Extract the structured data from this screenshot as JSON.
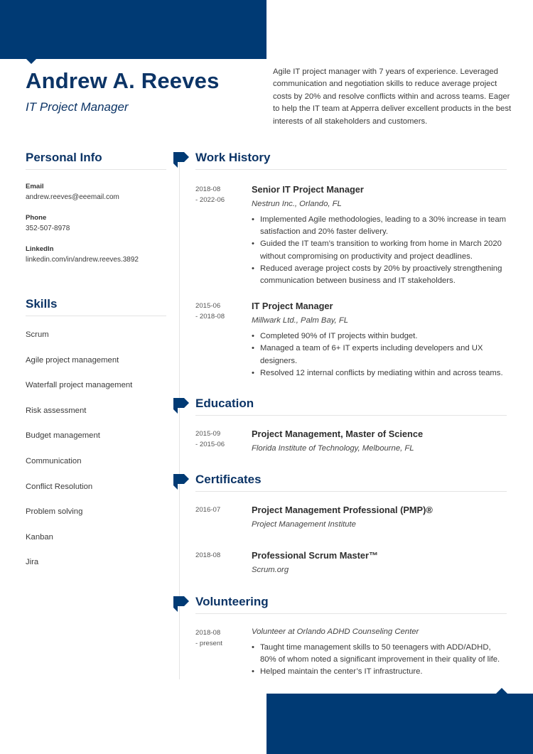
{
  "theme": {
    "accent": "#003a74",
    "heading": "#0c3466"
  },
  "header": {
    "name": "Andrew A. Reeves",
    "title": "IT Project Manager",
    "summary": "Agile IT project manager with 7 years of experience. Leveraged communication and negotiation skills to reduce average project costs by 20% and resolve conflicts within and across teams. Eager to help the IT team at Apperra deliver excellent products in the best interests of all stakeholders and customers."
  },
  "personal_info": {
    "title": "Personal Info",
    "items": [
      {
        "label": "Email",
        "value": "andrew.reeves@eeemail.com"
      },
      {
        "label": "Phone",
        "value": "352-507-8978"
      },
      {
        "label": "LinkedIn",
        "value": "linkedin.com/in/andrew.reeves.3892"
      }
    ]
  },
  "skills": {
    "title": "Skills",
    "items": [
      "Scrum",
      "Agile project management",
      "Waterfall project management",
      "Risk assessment",
      "Budget management",
      "Communication",
      "Conflict Resolution",
      "Problem solving",
      "Kanban",
      "Jira"
    ]
  },
  "work_history": {
    "title": "Work History",
    "entries": [
      {
        "date_start": "2018-08",
        "date_end": "- 2022-06",
        "role": "Senior IT Project Manager",
        "company": "Nestrun Inc., Orlando, FL",
        "bullets": [
          "Implemented Agile methodologies, leading to a 30% increase in team satisfaction and 20% faster delivery.",
          "Guided the IT team’s transition to working from home in March 2020 without compromising on productivity and project deadlines.",
          "Reduced average project costs by 20% by proactively strengthening communication between business and IT stakeholders."
        ]
      },
      {
        "date_start": "2015-06",
        "date_end": "- 2018-08",
        "role": "IT Project Manager",
        "company": "Millwark Ltd., Palm Bay, FL",
        "bullets": [
          "Completed 90% of IT projects within budget.",
          "Managed a team of 6+ IT experts including developers and UX designers.",
          "Resolved 12 internal conflicts by mediating within and across teams."
        ]
      }
    ]
  },
  "education": {
    "title": "Education",
    "entries": [
      {
        "date_start": "2015-09",
        "date_end": "- 2015-06",
        "degree": "Project Management, Master of Science",
        "school": "Florida Institute of Technology, Melbourne, FL"
      }
    ]
  },
  "certificates": {
    "title": "Certificates",
    "entries": [
      {
        "date": "2016-07",
        "name": "Project Management Professional (PMP)®",
        "issuer": "Project Management Institute"
      },
      {
        "date": "2018-08",
        "name": "Professional Scrum Master™",
        "issuer": "Scrum.org"
      }
    ]
  },
  "volunteering": {
    "title": "Volunteering",
    "entries": [
      {
        "date_start": "2018-08",
        "date_end": "- present",
        "role": "Volunteer at Orlando ADHD Counseling Center",
        "bullets": [
          "Taught time management skills to 50 teenagers with ADD/ADHD, 80% of whom noted a significant improvement in their quality of life.",
          "Helped maintain the center’s IT infrastructure."
        ]
      }
    ]
  }
}
